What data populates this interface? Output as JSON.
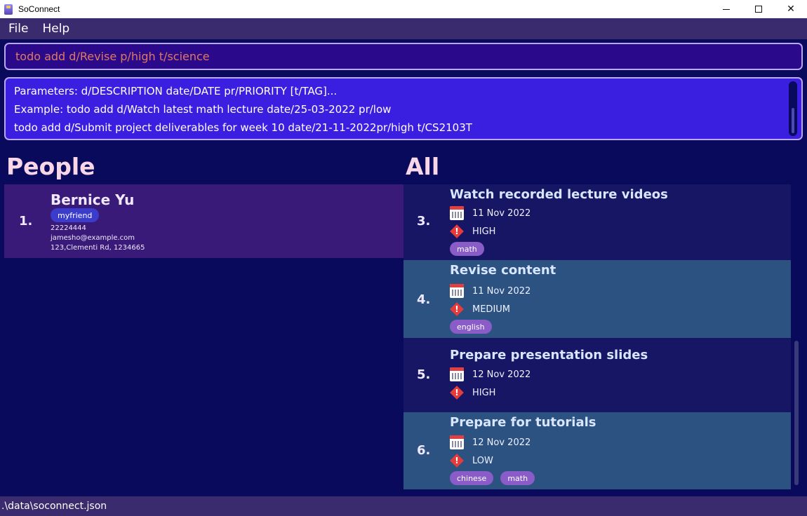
{
  "window": {
    "title": "SoConnect",
    "minimize_label": "",
    "close_label": "✕"
  },
  "menu": {
    "items": [
      "File",
      "Help"
    ]
  },
  "command": {
    "value": "todo add d/Revise p/high t/science"
  },
  "result": {
    "lines": [
      "Parameters: d/DESCRIPTION date/DATE pr/PRIORITY [t/TAG]...",
      "Example: todo add d/Watch latest math lecture date/25-03-2022 pr/low",
      "todo add d/Submit project deliverables for week 10 date/21-11-2022pr/high t/CS2103T"
    ]
  },
  "people": {
    "heading": "People",
    "items": [
      {
        "index": "1.",
        "name": "Bernice Yu",
        "tags": [
          "myfriend"
        ],
        "phone": "22224444",
        "email": "jamesho@example.com",
        "address": "123,Clementi Rd, 1234665"
      }
    ]
  },
  "todos": {
    "heading": "All",
    "items": [
      {
        "index": "3.",
        "description": "Watch recorded lecture videos",
        "date": "11 Nov 2022",
        "priority": "HIGH",
        "tags": [
          "math"
        ]
      },
      {
        "index": "4.",
        "description": "Revise content",
        "date": "11 Nov 2022",
        "priority": "MEDIUM",
        "tags": [
          "english"
        ]
      },
      {
        "index": "5.",
        "description": "Prepare presentation slides",
        "date": "12 Nov 2022",
        "priority": "HIGH",
        "tags": []
      },
      {
        "index": "6.",
        "description": "Prepare for tutorials",
        "date": "12 Nov 2022",
        "priority": "LOW",
        "tags": [
          "chinese",
          "math"
        ]
      }
    ]
  },
  "status": {
    "path": ".\\data\\soconnect.json"
  },
  "colors": {
    "background": "#0a0a5c",
    "command_text": "#e07a5f",
    "result_bg": "#3b1fe0",
    "person_card": "#3a1a78",
    "todo_dark": "#161665",
    "todo_light": "#2c5282",
    "tag_person": "#3b3bcc",
    "tag_todo": "#8a5cc8",
    "priority_icon": "#e53b3b"
  }
}
